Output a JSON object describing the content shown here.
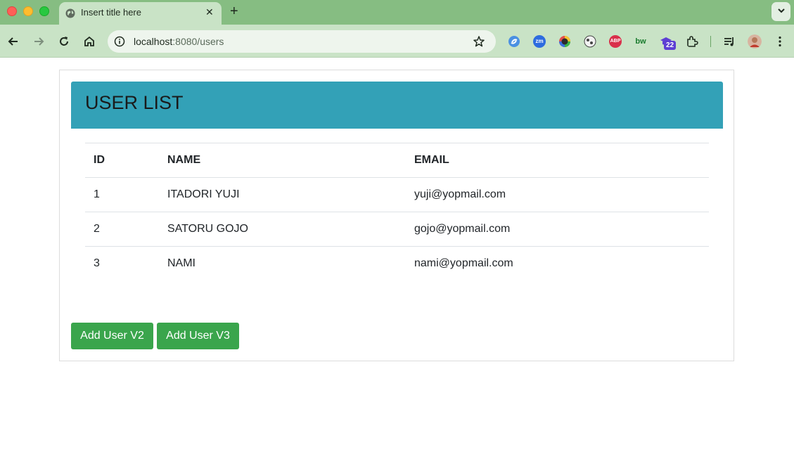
{
  "browser": {
    "tab_title": "Insert title here",
    "url_host": "localhost",
    "url_path": ":8080/users",
    "extension_badge": "22"
  },
  "page": {
    "title": "USER LIST",
    "table": {
      "headers": [
        "ID",
        "NAME",
        "EMAIL"
      ],
      "rows": [
        [
          "1",
          "ITADORI YUJI",
          "yuji@yopmail.com"
        ],
        [
          "2",
          "SATORU GOJO",
          "gojo@yopmail.com"
        ],
        [
          "3",
          "NAMI",
          "nami@yopmail.com"
        ]
      ]
    },
    "buttons": {
      "add_v2": "Add User V2",
      "add_v3": "Add User V3"
    }
  },
  "colors": {
    "header_bg": "#33a1b7",
    "button_bg": "#3aa54c",
    "chrome_tabstrip": "#86bd82",
    "chrome_toolbar": "#c9e3c6"
  },
  "extensions": [
    {
      "icon": "sync-icon",
      "label": ""
    },
    {
      "icon": "zoom-extension-icon",
      "label": "zm"
    },
    {
      "icon": "color-picker-icon",
      "label": ""
    },
    {
      "icon": "cookie-icon",
      "label": ""
    },
    {
      "icon": "adblock-plus-icon",
      "label": "ABP"
    },
    {
      "icon": "bitwarden-icon",
      "label": "bw"
    },
    {
      "icon": "graduation-cap-icon",
      "label": ""
    },
    {
      "icon": "extensions-puzzle-icon",
      "label": ""
    }
  ]
}
